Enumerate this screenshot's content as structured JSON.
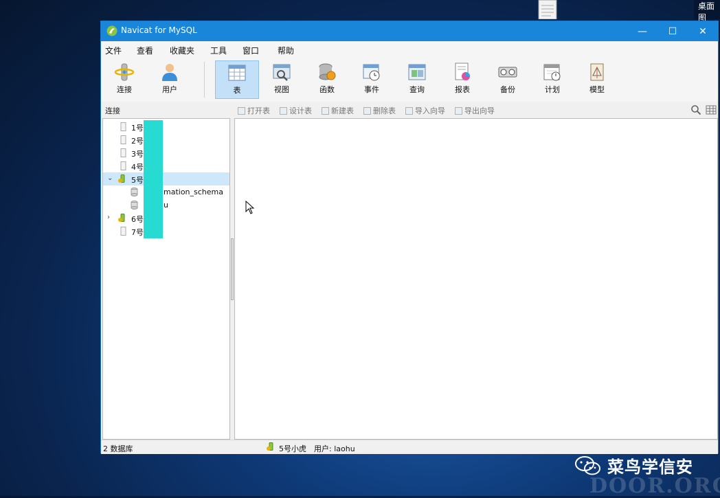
{
  "desktop": {
    "corner_label": "桌面图"
  },
  "window": {
    "title": "Navicat for MySQL",
    "controls": {
      "minimize": "—",
      "maximize": "☐",
      "close": "✕"
    }
  },
  "menu": [
    "文件",
    "查看",
    "收藏夹",
    "工具",
    "窗口",
    "帮助"
  ],
  "toolbar": [
    {
      "label": "连接",
      "icon": "connection-icon"
    },
    {
      "label": "用户",
      "icon": "user-icon"
    },
    {
      "label": "表",
      "icon": "table-icon",
      "active": true
    },
    {
      "label": "视图",
      "icon": "view-icon"
    },
    {
      "label": "函数",
      "icon": "function-icon"
    },
    {
      "label": "事件",
      "icon": "event-icon"
    },
    {
      "label": "查询",
      "icon": "query-icon"
    },
    {
      "label": "报表",
      "icon": "report-icon"
    },
    {
      "label": "备份",
      "icon": "backup-icon"
    },
    {
      "label": "计划",
      "icon": "schedule-icon"
    },
    {
      "label": "模型",
      "icon": "model-icon"
    }
  ],
  "subtoolbar": {
    "panel_label": "连接",
    "buttons": [
      "打开表",
      "设计表",
      "新建表",
      "删除表",
      "导入向导",
      "导出向导"
    ]
  },
  "tree": [
    {
      "label": "1号",
      "type": "connection",
      "expanded": false
    },
    {
      "label": "2号",
      "type": "connection",
      "expanded": false
    },
    {
      "label": "3号",
      "type": "connection",
      "expanded": false
    },
    {
      "label": "4号",
      "type": "connection",
      "expanded": false
    },
    {
      "label": "5号",
      "type": "connection-open",
      "expanded": true,
      "selected": true
    },
    {
      "label": "mation_schema",
      "type": "database"
    },
    {
      "label": "u",
      "type": "database"
    },
    {
      "label": "6号",
      "type": "connection-open",
      "expanded": false
    },
    {
      "label": "7号",
      "type": "connection",
      "expanded": false
    }
  ],
  "status": {
    "db_count": "2 数据库",
    "connection": "5号小虎",
    "user": "用户: laohu"
  },
  "watermark": {
    "text": "菜鸟学信安",
    "sub": "DOOR.ORG"
  },
  "colors": {
    "titlebar": "#1a86d9",
    "active_tool": "#c4e0f8",
    "tree_selected": "#cde8fb",
    "redaction": "#27dbd3"
  }
}
